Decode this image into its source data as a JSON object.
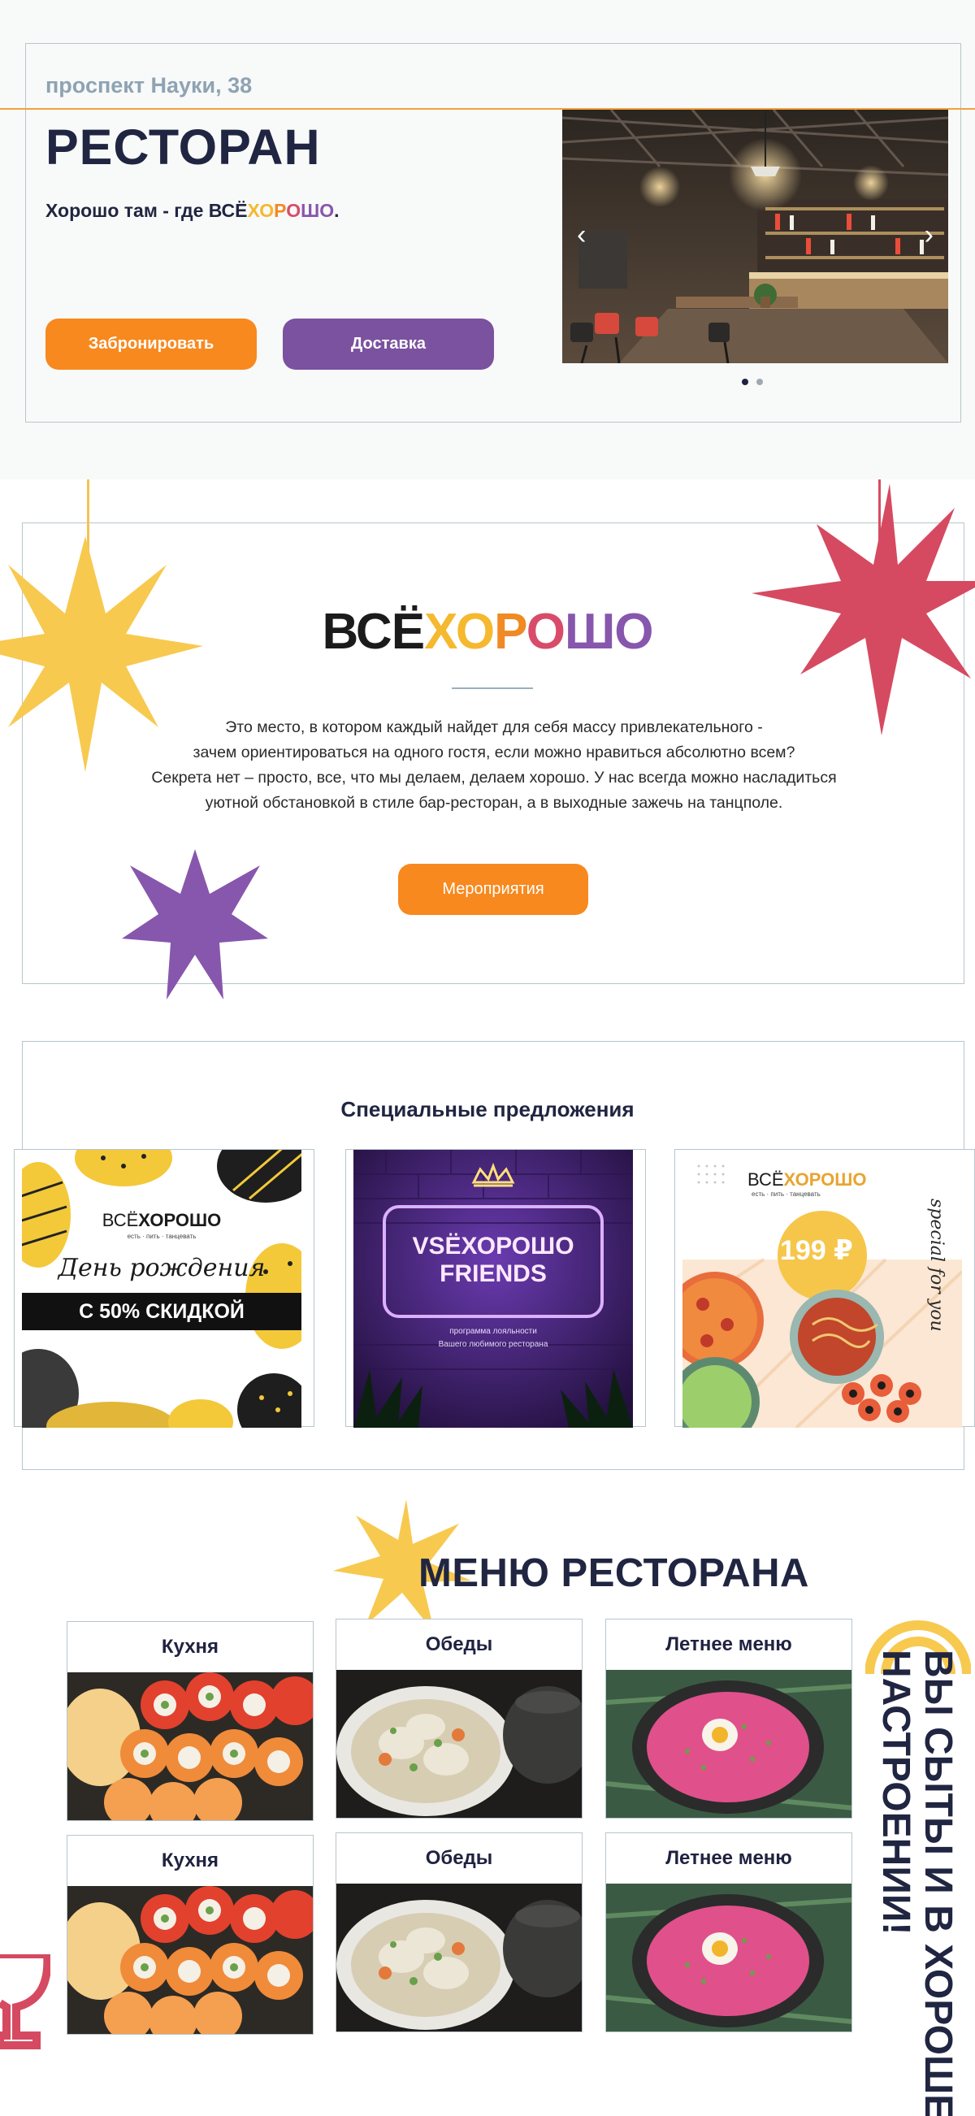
{
  "hero": {
    "address": "проспект Науки, 38",
    "title": "РЕСТОРАН",
    "tagline_prefix": "Хорошо там - где ВСЁ",
    "tagline_brand": [
      "Х",
      "О",
      "Р",
      "О",
      "Ш",
      "О"
    ],
    "tagline_suffix": ".",
    "book_button": "Забронировать",
    "delivery_button": "Доставка",
    "slider_prev": "‹",
    "slider_next": "›",
    "slides_count": 2,
    "active_slide": 1
  },
  "about": {
    "logo_prefix": "ВСЁ",
    "logo_letters": [
      "Х",
      "О",
      "Р",
      "О",
      "Ш",
      "О"
    ],
    "text_lines": [
      "Это место, в котором каждый найдет для себя массу привлекательного -",
      "зачем ориентироваться на одного гостя, если можно нравиться абсолютно всем?",
      "Секрета нет – просто, все, что мы делаем, делаем хорошо. У нас всегда можно насладиться",
      "уютной обстановкой в стиле бар-ресторан, а в выходные зажечь на танцполе."
    ],
    "events_button": "Мероприятия"
  },
  "offers": {
    "title": "Специальные предложения",
    "birthday": {
      "logo_prefix": "ВСЁ",
      "logo_word": "ХОРОШО",
      "logo_sub": "есть · пить · танцевать",
      "script_title": "День рождения",
      "discount": "С 50% СКИДКОЙ"
    },
    "friends": {
      "line1": "VSЁХОРОШО",
      "line2": "FRIENDS",
      "sub1": "программа лояльности",
      "sub2": "Вашего любимого ресторана"
    },
    "special": {
      "logo_prefix": "ВСЁ",
      "logo_word": "ХОРОШО",
      "logo_sub": "есть · пить · танцевать",
      "price": "199 ₽",
      "script": "special for you"
    }
  },
  "menu": {
    "title": "МЕНЮ РЕСТОРАНА",
    "cards": [
      {
        "label": "Кухня"
      },
      {
        "label": "Обеды"
      },
      {
        "label": "Летнее меню"
      },
      {
        "label": "Кухня"
      },
      {
        "label": "Обеды"
      },
      {
        "label": "Летнее меню"
      }
    ],
    "side_text_line1": "ВЫ СЫТЫ И В ХОРОШЕМ",
    "side_text_line2": "НАСТРОЕНИИ!"
  },
  "colors": {
    "orange": "#f7891f",
    "purple": "#7b529f",
    "navy": "#202541",
    "yellow": "#f5b82e",
    "red": "#d84c6a",
    "border": "#b8c6cd"
  },
  "icons": [
    "chevron-left-icon",
    "chevron-right-icon",
    "star-decoration-icon",
    "crown-icon",
    "wine-glass-icon"
  ]
}
